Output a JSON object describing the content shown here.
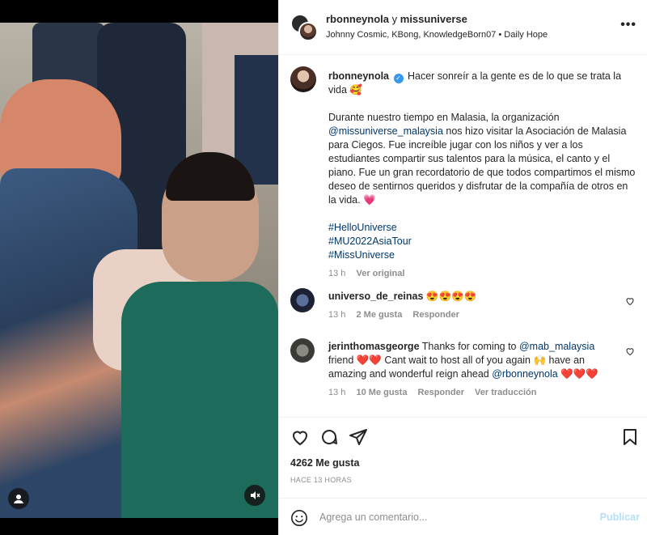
{
  "header": {
    "user1": "rbonneynola",
    "connector": "y",
    "user2": "missuniverse",
    "audio": "Johnny Cosmic, KBong, KnowledgeBorn07 • Daily Hope"
  },
  "caption": {
    "username": "rbonneynola",
    "line1": "Hacer sonreír a la gente es de lo que se trata la vida 🥰",
    "body_pre": "Durante nuestro tiempo en Malasia, la organización ",
    "mention": "@missuniverse_malaysia",
    "body_post": " nos hizo visitar la Asociación de Malasia para Ciegos. Fue increíble jugar con los niños y ver a los estudiantes compartir sus talentos para la música, el canto y el piano. Fue un gran recordatorio de que todos compartimos el mismo deseo de sentirnos queridos y disfrutar de la compañía de otros en la vida. 💗",
    "hashtags": [
      "#HelloUniverse",
      "#MU2022AsiaTour",
      "#MissUniverse"
    ],
    "time": "13 h",
    "see_original": "Ver original"
  },
  "comments": [
    {
      "username": "universo_de_reinas",
      "text": "😍😍😍😍",
      "time": "13 h",
      "likes": "2 Me gusta",
      "reply": "Responder"
    },
    {
      "username": "jerinthomasgeorge",
      "text_pre": "Thanks for coming to ",
      "mention1": "@mab_malaysia",
      "text_mid": " friend ❤️❤️ Cant wait to host all of you again 🙌 have an amazing and wonderful reign ahead ",
      "mention2": "@rbonneynola",
      "text_post": " ❤️❤️❤️",
      "time": "13 h",
      "likes": "10 Me gusta",
      "reply": "Responder",
      "translate": "Ver traducción"
    }
  ],
  "footer": {
    "likes": "4262 Me gusta",
    "time_ago": "HACE 13 HORAS",
    "comment_placeholder": "Agrega un comentario...",
    "publish": "Publicar"
  },
  "colors": {
    "link": "#00376b",
    "verified": "#3897f0",
    "publish_disabled": "#b2dffc",
    "muted": "#8e8e8e"
  }
}
